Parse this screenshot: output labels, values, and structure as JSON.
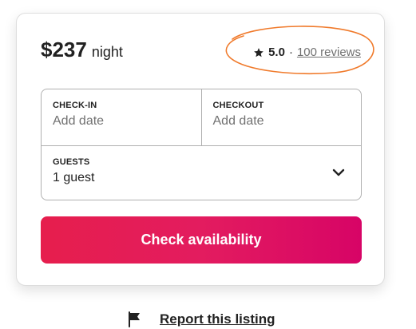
{
  "listing": {
    "price": "$237",
    "price_unit": "night"
  },
  "rating": {
    "icon": "star-icon",
    "value": "5.0",
    "separator": "·",
    "reviews_label": "100 reviews"
  },
  "booking": {
    "checkin_label": "CHECK-IN",
    "checkin_placeholder": "Add date",
    "checkout_label": "CHECKOUT",
    "checkout_placeholder": "Add date",
    "guests_label": "GUESTS",
    "guests_value": "1 guest",
    "guests_icon": "chevron-down-icon"
  },
  "actions": {
    "check_availability_label": "Check availability"
  },
  "footer": {
    "flag_icon": "flag-icon",
    "report_label": "Report this listing"
  },
  "colors": {
    "accent_start": "#e61e4d",
    "accent_end": "#d70466",
    "annotation": "#f07a2b",
    "text_primary": "#222222",
    "text_secondary": "#717171"
  }
}
